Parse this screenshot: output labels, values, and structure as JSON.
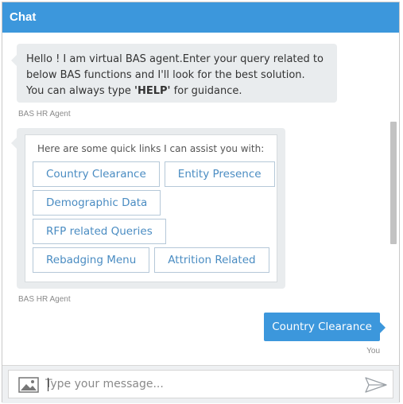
{
  "header": {
    "title": "Chat"
  },
  "messages": {
    "welcome": {
      "line1": "Hello ! I am virtual BAS agent.Enter your query related to",
      "line2": "below BAS functions and I'll look for the best solution.",
      "line3_prefix": "You can always type ",
      "line3_help": "'HELP'",
      "line3_suffix": " for guidance.",
      "sender": "BAS HR Agent"
    },
    "quick_links": {
      "intro": "Here are some quick links I can assist you with:",
      "rows": [
        [
          "Country Clearance",
          "Entity Presence"
        ],
        [
          "Demographic Data"
        ],
        [
          "RFP related Queries"
        ],
        [
          "Rebadging Menu",
          "Attrition Related"
        ]
      ],
      "sender": "BAS HR Agent"
    },
    "user_message": {
      "text": "Country Clearance",
      "sender": "You"
    }
  },
  "composer": {
    "placeholder": "Type your message..."
  },
  "colors": {
    "accent": "#3c97dc",
    "bubble": "#e9ecee",
    "link": "#4a8cc2"
  },
  "icons": {
    "attach": "image-icon",
    "send": "send-icon"
  }
}
